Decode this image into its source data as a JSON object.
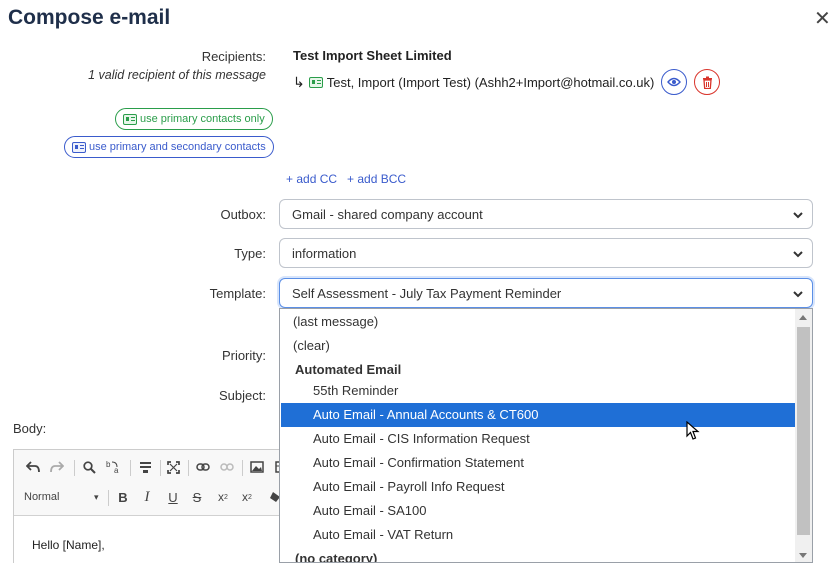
{
  "dialog": {
    "title": "Compose e-mail"
  },
  "recipients": {
    "label": "Recipients:",
    "count_note": "1 valid recipient of this message",
    "company": "Test Import Sheet Limited",
    "arrow": "↳",
    "contact": "Test, Import (Import Test) (Ashh2+Import@hotmail.co.uk)",
    "btn_primary_only": "use primary contacts only",
    "btn_primary_secondary": "use primary and secondary contacts",
    "add_cc": "+ add CC",
    "add_bcc": "+ add BCC"
  },
  "fields": {
    "outbox_label": "Outbox:",
    "outbox_value": "Gmail - shared company account",
    "type_label": "Type:",
    "type_value": "information",
    "template_label": "Template:",
    "template_value": "Self Assessment - July Tax Payment Reminder",
    "priority_label": "Priority:",
    "subject_label": "Subject:",
    "body_label": "Body:"
  },
  "dropdown": {
    "items": [
      {
        "text": "(last message)",
        "kind": "option"
      },
      {
        "text": "(clear)",
        "kind": "option"
      },
      {
        "text": "Automated Email",
        "kind": "group"
      },
      {
        "text": "55th Reminder",
        "kind": "option"
      },
      {
        "text": "Auto Email - Annual Accounts & CT600",
        "kind": "selected"
      },
      {
        "text": "Auto Email - CIS Information Request",
        "kind": "option"
      },
      {
        "text": "Auto Email - Confirmation Statement",
        "kind": "option"
      },
      {
        "text": "Auto Email - Payroll Info Request",
        "kind": "option"
      },
      {
        "text": "Auto Email - SA100",
        "kind": "option"
      },
      {
        "text": "Auto Email - VAT Return",
        "kind": "option"
      },
      {
        "text": "(no category)",
        "kind": "group"
      }
    ]
  },
  "editor": {
    "format_select": "Normal",
    "body_text": "Hello [Name],",
    "toolbar_icons": [
      "undo-icon",
      "redo-icon",
      "find-icon",
      "replace-icon",
      "show-blocks-icon",
      "maximize-icon",
      "link-icon",
      "unlink-icon",
      "image-icon",
      "table-icon",
      "format-dropdown",
      "bold-icon",
      "italic-icon",
      "underline-icon",
      "strikethrough-icon",
      "subscript-icon",
      "superscript-icon",
      "remove-format-icon"
    ]
  },
  "colors": {
    "accent_blue": "#3a5bcc",
    "green": "#2a9d4a",
    "red": "#d9342b",
    "selected_bg": "#1f6fd6",
    "title": "#1f2f4a"
  }
}
